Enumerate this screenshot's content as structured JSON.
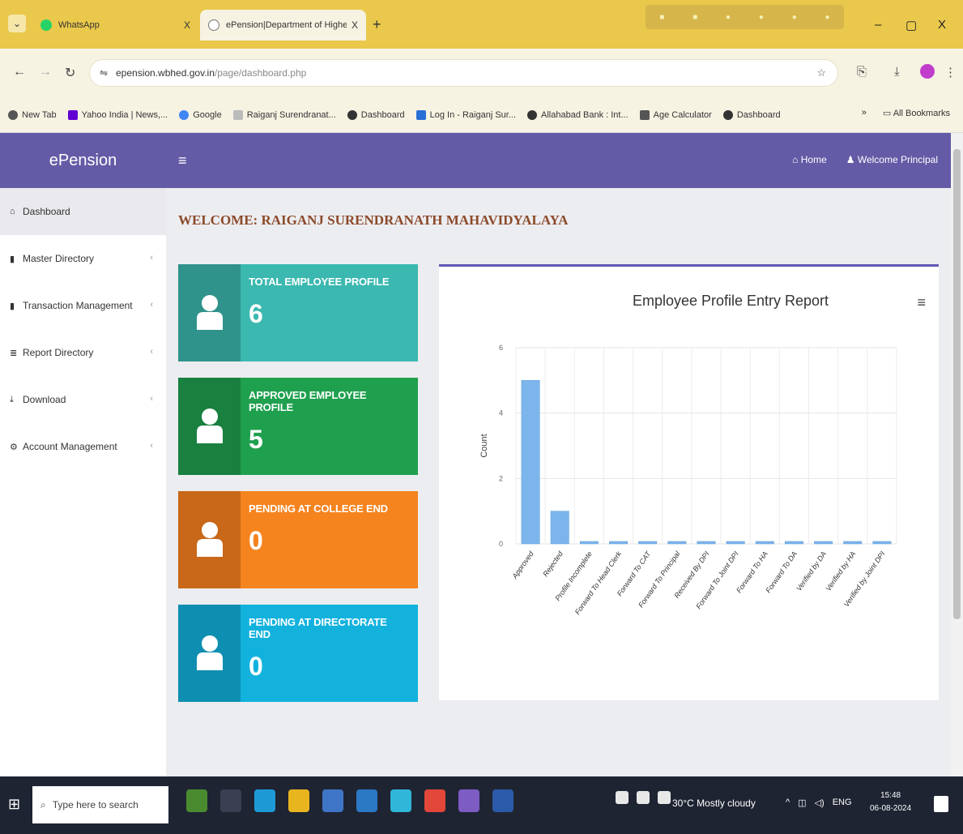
{
  "browser": {
    "tabs": [
      {
        "title": "WhatsApp",
        "close": "X",
        "favicon_color": "#25d366"
      },
      {
        "title": "ePension|Department of Highe",
        "close": "X",
        "favicon_color": "#6f6f6f"
      }
    ],
    "new_tab": "+",
    "url_host": "epension.wbhed.gov.in",
    "url_path": "/page/dashboard.php",
    "window_controls": [
      "–",
      "▢",
      "X"
    ],
    "bookmarks": [
      {
        "label": "New Tab",
        "color": "#555"
      },
      {
        "label": "Yahoo India | News,...",
        "color": "#5f01d1"
      },
      {
        "label": "Google",
        "color": "#4285f4"
      },
      {
        "label": "Raiganj Surendranat...",
        "color": "#bbbbbb"
      },
      {
        "label": "Dashboard",
        "color": "#333"
      },
      {
        "label": "Log In - Raiganj Sur...",
        "color": "#2a6fd6"
      },
      {
        "label": "Allahabad Bank : Int...",
        "color": "#333"
      },
      {
        "label": "Age Calculator",
        "color": "#555"
      },
      {
        "label": "Dashboard",
        "color": "#333"
      }
    ],
    "bookmarks_more": "»",
    "all_bookmarks": "All Bookmarks"
  },
  "header": {
    "brand": "ePension",
    "home": "Home",
    "welcome_user": "Welcome Principal",
    "color": "#635ba6"
  },
  "sidebar": {
    "items": [
      {
        "label": "Dashboard",
        "icon": "dashboard-icon",
        "active": true
      },
      {
        "label": "Master Directory",
        "icon": "book-icon"
      },
      {
        "label": "Transaction Management",
        "icon": "book-icon"
      },
      {
        "label": "Report Directory",
        "icon": "database-icon"
      },
      {
        "label": "Download",
        "icon": "download-icon"
      },
      {
        "label": "Account Management",
        "icon": "cogs-icon"
      }
    ]
  },
  "main": {
    "welcome": "WELCOME: RAIGANJ SURENDRANATH MAHAVIDYALAYA",
    "cards": [
      {
        "title": "TOTAL EMPLOYEE PROFILE",
        "value": "6",
        "color": "#3bb8b0",
        "icon_bg": "#2f938c"
      },
      {
        "title": "APPROVED EMPLOYEE PROFILE",
        "value": "5",
        "color": "#1fa04f",
        "icon_bg": "#198040"
      },
      {
        "title": "PENDING AT COLLEGE END",
        "value": "0",
        "color": "#f5841f",
        "icon_bg": "#c86818"
      },
      {
        "title": "PENDING AT DIRECTORATE END",
        "value": "0",
        "color": "#12b2dd",
        "icon_bg": "#0e8eb1"
      }
    ]
  },
  "chart_data": {
    "type": "bar",
    "title": "Employee Profile Entry Report",
    "ylabel": "Count",
    "xlabel": "",
    "categories": [
      "Approved",
      "Rejected",
      "Profile Incomplete",
      "Forward To Head Clerk",
      "Forward To CAT",
      "Forward To Principal",
      "Received By DPI",
      "Forward To Joint DPI",
      "Forward To HA",
      "Forward To DA",
      "Verified by DA",
      "Verified by HA",
      "Verified by Joint DPI"
    ],
    "values": [
      5,
      1,
      0,
      0,
      0,
      0,
      0,
      0,
      0,
      0,
      0,
      0,
      0
    ],
    "ylim": [
      0,
      6
    ],
    "yticks": [
      0,
      2,
      4,
      6
    ],
    "bar_color": "#7cb5ec",
    "grid": true
  },
  "taskbar": {
    "search_placeholder": "Type here to search",
    "weather": "30°C  Mostly cloudy",
    "lang": "ENG",
    "time": "15:48",
    "date": "06-08-2024"
  }
}
